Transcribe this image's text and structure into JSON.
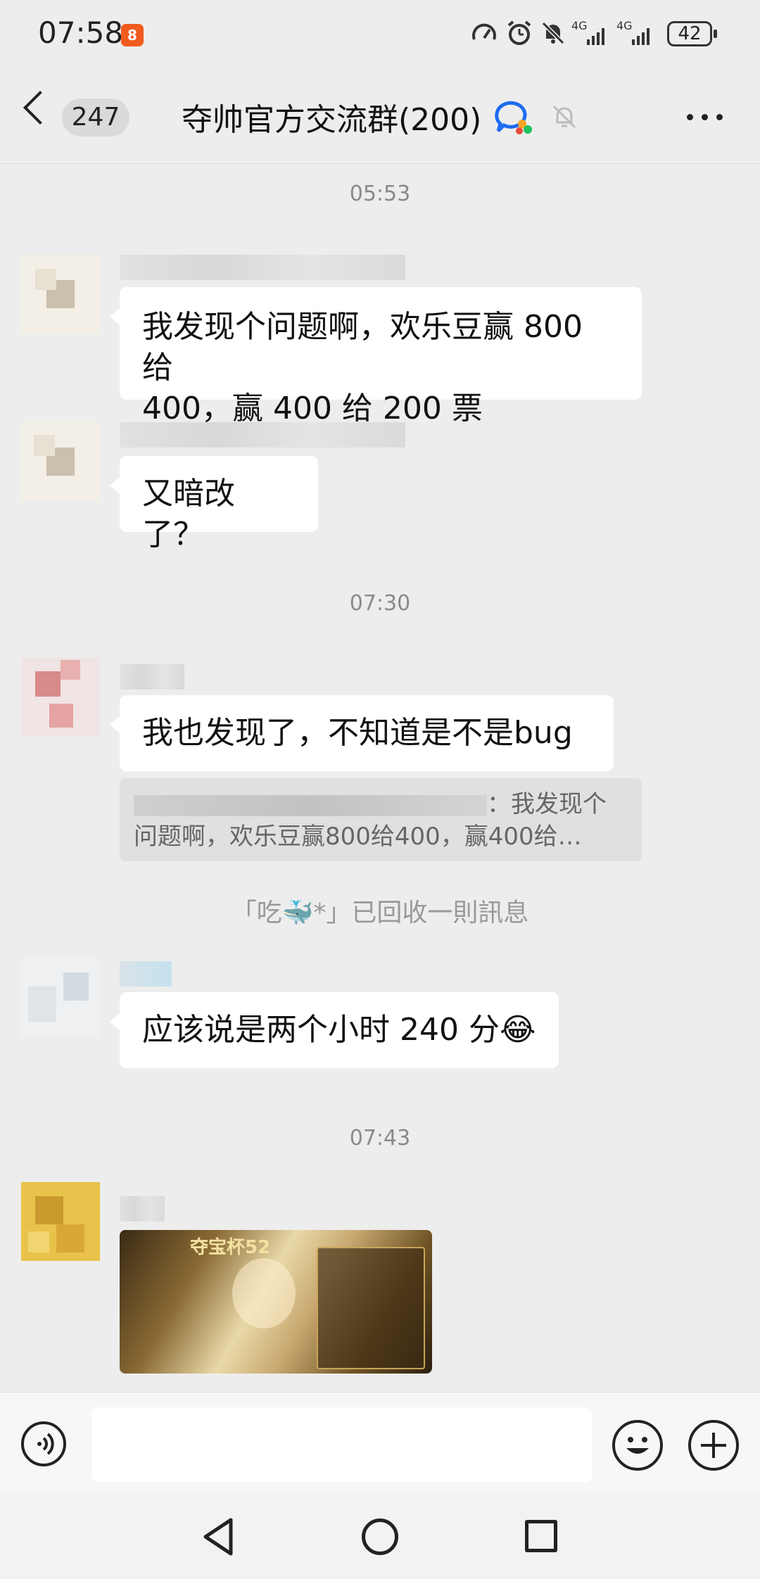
{
  "status_bar": {
    "time": "07:58",
    "app_badge": "8",
    "network_1": "4G",
    "network_2": "4G",
    "battery": "42"
  },
  "header": {
    "unread_count": "247",
    "title": "夺帅官方交流群(200)"
  },
  "messages": [
    {
      "type": "time",
      "text": "05:53"
    },
    {
      "type": "text",
      "text_line1": "我发现个问题啊，欢乐豆赢 800 给",
      "text_line2": "400，赢 400 给 200 票"
    },
    {
      "type": "text",
      "text": "又暗改了？"
    },
    {
      "type": "time",
      "text": "07:30"
    },
    {
      "type": "text",
      "text": "我也发现了，不知道是不是bug"
    },
    {
      "type": "quote",
      "text_line1": "：我发现个",
      "text_line2": "问题啊，欢乐豆赢800给400，赢400给…"
    },
    {
      "type": "system",
      "text": "「吃🐳*」已回收一則訊息"
    },
    {
      "type": "text",
      "text": "应该说是两个小时 240 分😂"
    },
    {
      "type": "time",
      "text": "07:43"
    },
    {
      "type": "image",
      "caption": "夺宝杯52"
    }
  ],
  "icons": {
    "back": "back-chevron-icon",
    "group_badge": "group-chat-icon",
    "mute": "bell-off-icon",
    "more": "more-dots-icon",
    "voice": "voice-input-icon",
    "emoji": "emoji-icon",
    "plus": "plus-icon",
    "nav_back": "nav-back-icon",
    "nav_home": "nav-home-icon",
    "nav_recent": "nav-recent-icon"
  },
  "colors": {
    "background": "#ededed",
    "bubble": "#ffffff",
    "badge_orange": "#f25a1e"
  }
}
